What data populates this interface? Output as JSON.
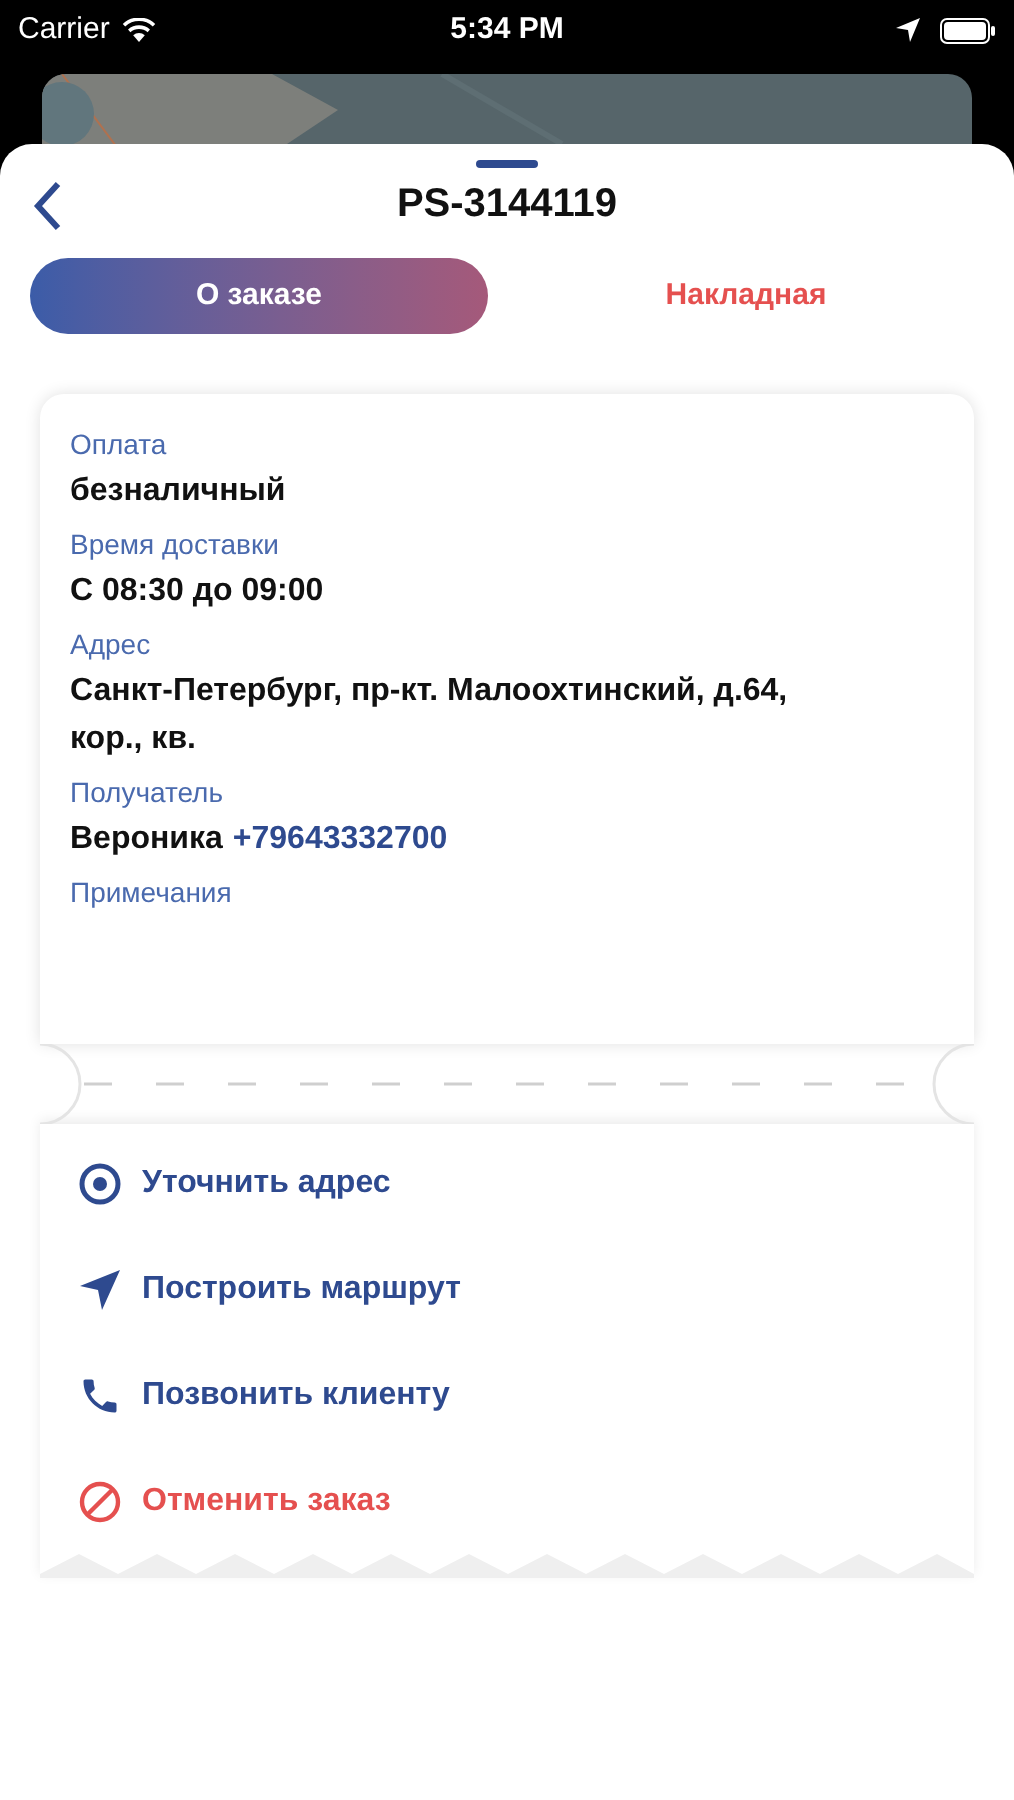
{
  "status_bar": {
    "carrier": "Carrier",
    "time": "5:34 PM"
  },
  "header": {
    "title": "PS-3144119"
  },
  "tabs": [
    {
      "label": "О заказе",
      "selected": true
    },
    {
      "label": "Накладная",
      "selected": false
    }
  ],
  "details": [
    {
      "label": "Оплата",
      "value": "безналичный"
    },
    {
      "label": "Время доставки",
      "value": "С 08:30 до 09:00"
    },
    {
      "label": "Адрес",
      "value": "Санкт-Петербург, пр-кт. Малоохтинский, д.64, кор., кв."
    },
    {
      "label": "Получатель",
      "value": "Вероника",
      "phone": "+79643332700"
    },
    {
      "label": "Примечания"
    }
  ],
  "actions": [
    {
      "kind": "locate",
      "label": "Уточнить адрес"
    },
    {
      "kind": "route",
      "label": "Построить маршрут"
    },
    {
      "kind": "call",
      "label": "Позвонить клиенту"
    },
    {
      "kind": "cancel",
      "label": "Отменить заказ"
    }
  ]
}
